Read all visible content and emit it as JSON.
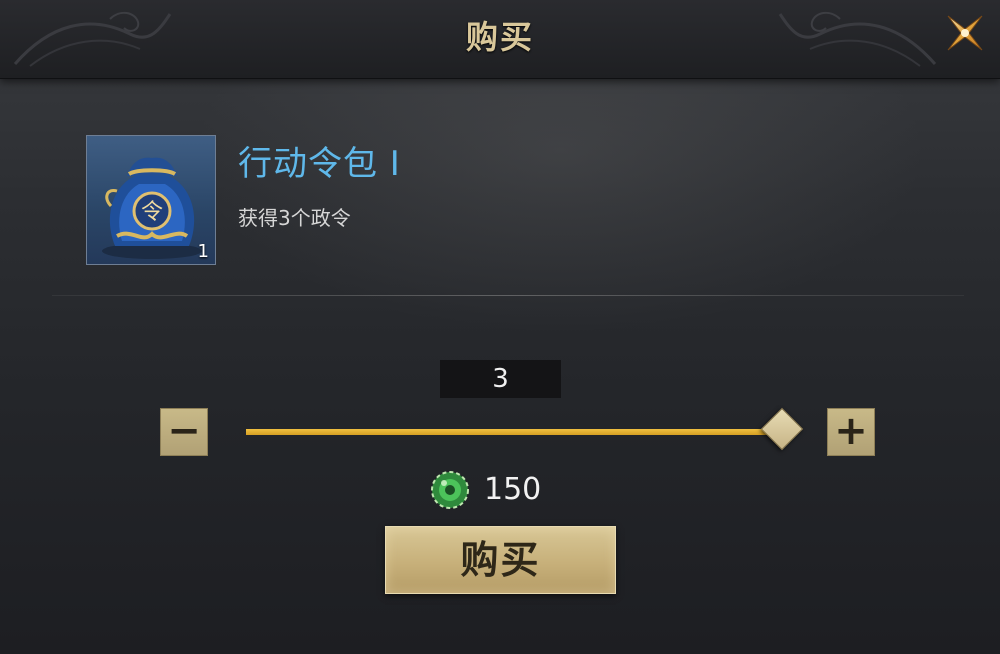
{
  "header": {
    "title": "购买",
    "close_icon": "close-x-icon"
  },
  "item": {
    "name": "行动令包 I",
    "description": "获得3个政令",
    "count": "1",
    "icon": "token-pouch-icon",
    "icon_glyph": "令"
  },
  "purchase": {
    "quantity": "3",
    "quantity_fraction": 1.0,
    "minus_label": "−",
    "plus_label": "+",
    "currency_icon": "jade-coin-icon",
    "price": "150",
    "buy_label": "购买"
  },
  "colors": {
    "title_gold": "#d9c79a",
    "item_name_blue": "#5fb8ea",
    "slider_fill": "#e0ad2e",
    "button_gold": "#c7b07a"
  }
}
